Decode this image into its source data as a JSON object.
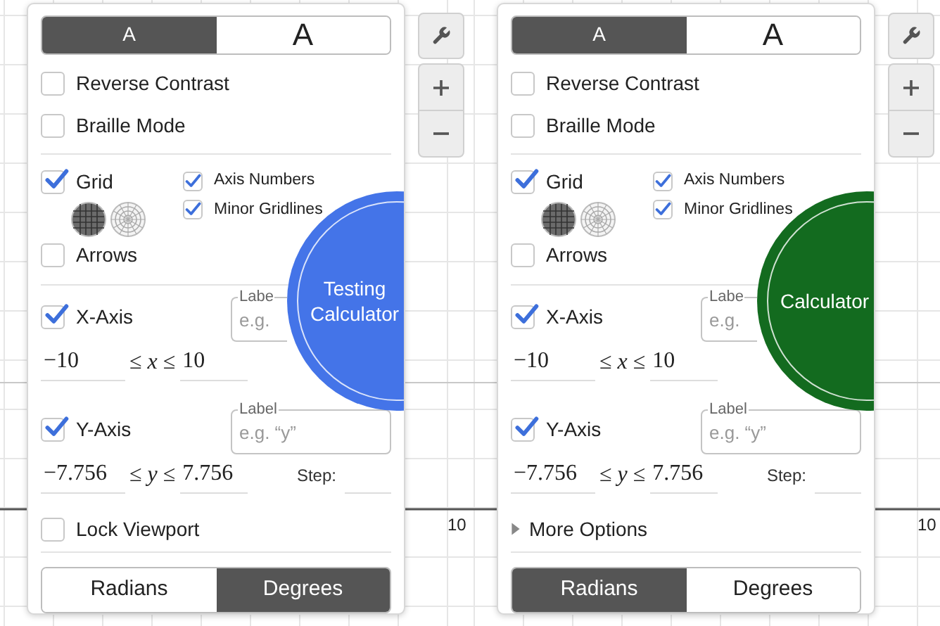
{
  "panels": [
    {
      "text_sizes": [
        {
          "label": "A",
          "selected": true
        },
        {
          "label": "A",
          "selected": false
        }
      ],
      "toggles": [
        {
          "label": "Reverse Contrast",
          "checked": false
        },
        {
          "label": "Braille Mode",
          "checked": false
        }
      ],
      "grid": {
        "label": "Grid",
        "checked": true
      },
      "grid_types": [
        {
          "kind": "cartesian",
          "selected": true
        },
        {
          "kind": "polar",
          "selected": false
        }
      ],
      "grid_options": [
        {
          "label": "Axis Numbers",
          "checked": true
        },
        {
          "label": "Minor Gridlines",
          "checked": true
        }
      ],
      "arrows": {
        "label": "Arrows",
        "checked": false
      },
      "axes": [
        {
          "label": "X-Axis",
          "checked": true,
          "legend": "Labe",
          "placeholder": "e.g.",
          "min": "−10",
          "relation": [
            "≤",
            "x",
            "≤"
          ],
          "max": "10"
        },
        {
          "label": "Y-Axis",
          "checked": true,
          "legend": "Label",
          "placeholder": "e.g. “y”",
          "min": "−7.756",
          "relation": [
            "≤",
            "y",
            "≤"
          ],
          "max": "7.756",
          "step_label": "Step:"
        }
      ],
      "footer_option": {
        "kind": "checkbox",
        "label": "Lock Viewport",
        "checked": false
      },
      "angle_units": [
        {
          "label": "Radians",
          "selected": false
        },
        {
          "label": "Degrees",
          "selected": true
        }
      ],
      "badge": {
        "text": "Testing Calculator",
        "color": "#4474e8"
      },
      "axis_tick": "10"
    },
    {
      "text_sizes": [
        {
          "label": "A",
          "selected": true
        },
        {
          "label": "A",
          "selected": false
        }
      ],
      "toggles": [
        {
          "label": "Reverse Contrast",
          "checked": false
        },
        {
          "label": "Braille Mode",
          "checked": false
        }
      ],
      "grid": {
        "label": "Grid",
        "checked": true
      },
      "grid_types": [
        {
          "kind": "cartesian",
          "selected": true
        },
        {
          "kind": "polar",
          "selected": false
        }
      ],
      "grid_options": [
        {
          "label": "Axis Numbers",
          "checked": true
        },
        {
          "label": "Minor Gridlines",
          "checked": true
        }
      ],
      "arrows": {
        "label": "Arrows",
        "checked": false
      },
      "axes": [
        {
          "label": "X-Axis",
          "checked": true,
          "legend": "Labe",
          "placeholder": "e.g.",
          "min": "−10",
          "relation": [
            "≤",
            "x",
            "≤"
          ],
          "max": "10"
        },
        {
          "label": "Y-Axis",
          "checked": true,
          "legend": "Label",
          "placeholder": "e.g. “y”",
          "min": "−7.756",
          "relation": [
            "≤",
            "y",
            "≤"
          ],
          "max": "7.756",
          "step_label": "Step:"
        }
      ],
      "footer_option": {
        "kind": "disclosure",
        "label": "More Options",
        "expanded": false
      },
      "angle_units": [
        {
          "label": "Radians",
          "selected": true
        },
        {
          "label": "Degrees",
          "selected": false
        }
      ],
      "badge": {
        "text": "Calculator",
        "color": "#136b1f"
      },
      "axis_tick": "10"
    }
  ]
}
